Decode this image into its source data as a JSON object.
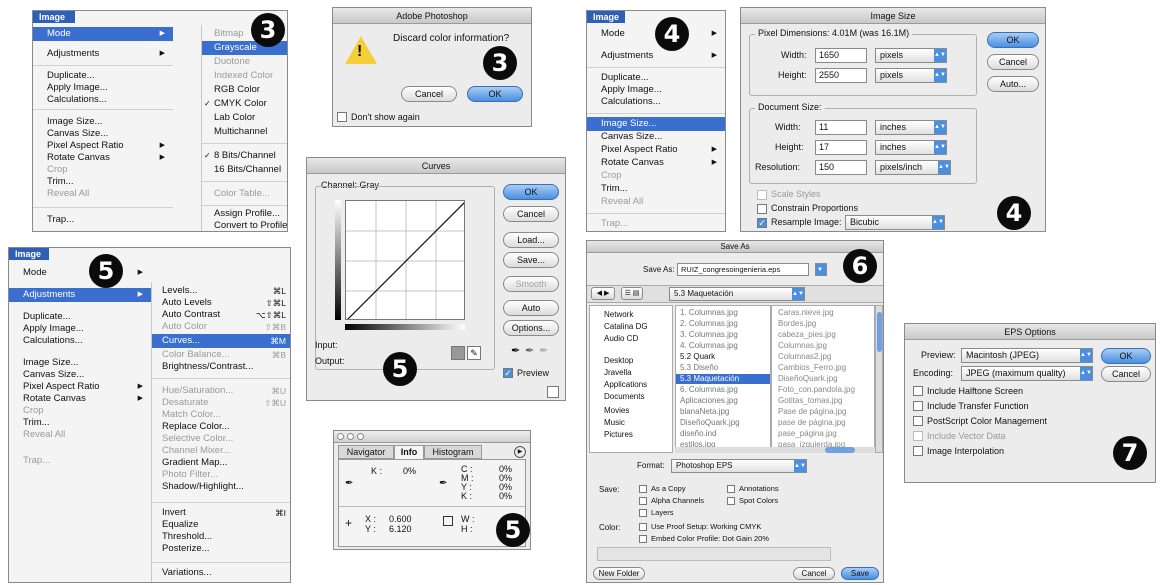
{
  "badges": [
    "3",
    "3",
    "4",
    "4",
    "5",
    "5",
    "5",
    "6",
    "7"
  ],
  "menu_mode": {
    "menubar": "Image",
    "items": [
      "Mode",
      "Adjustments",
      "Duplicate...",
      "Apply Image...",
      "Calculations...",
      "Image Size...",
      "Canvas Size...",
      "Pixel Aspect Ratio",
      "Rotate Canvas",
      "Crop",
      "Trim...",
      "Reveal All",
      "Trap..."
    ],
    "submenu": [
      "Bitmap",
      "Grayscale",
      "Duotone",
      "Indexed Color",
      "RGB Color",
      "CMYK Color",
      "Lab Color",
      "Multichannel",
      "8 Bits/Channel",
      "16 Bits/Channel",
      "Color Table...",
      "Assign Profile...",
      "Convert to Profile..."
    ],
    "check": "✓"
  },
  "alert": {
    "title": "Adobe Photoshop",
    "message": "Discard color information?",
    "cancel": "Cancel",
    "ok": "OK",
    "dont_show": "Don't show again"
  },
  "menu_imagesize": {
    "menubar": "Image",
    "items": [
      "Mode",
      "Adjustments",
      "Duplicate...",
      "Apply Image...",
      "Calculations...",
      "Image Size...",
      "Canvas Size...",
      "Pixel Aspect Ratio",
      "Rotate Canvas",
      "Crop",
      "Trim...",
      "Reveal All",
      "Trap..."
    ]
  },
  "image_size": {
    "title": "Image Size",
    "pixel_dims": "Pixel Dimensions:",
    "pixel_dims_value": "4.01M (was 16.1M)",
    "width_label": "Width:",
    "width_px": "1650",
    "height_label": "Height:",
    "height_px": "2550",
    "unit_px": "pixels",
    "doc_size": "Document Size:",
    "doc_width": "11",
    "doc_height": "17",
    "unit_in": "inches",
    "res_label": "Resolution:",
    "res": "150",
    "unit_res": "pixels/inch",
    "scale_styles": "Scale Styles",
    "constrain": "Constrain Proportions",
    "resample": "Resample Image:",
    "resample_mode": "Bicubic",
    "ok": "OK",
    "cancel": "Cancel",
    "auto": "Auto..."
  },
  "curves": {
    "title": "Curves",
    "channel_label": "Channel:",
    "channel": "Gray",
    "input": "Input:",
    "output": "Output:",
    "ok": "OK",
    "cancel": "Cancel",
    "load": "Load...",
    "save": "Save...",
    "smooth": "Smooth",
    "auto": "Auto",
    "options": "Options...",
    "preview": "Preview"
  },
  "menu_adjust": {
    "menubar": "Image",
    "items": [
      "Mode",
      "Adjustments",
      "Duplicate...",
      "Apply Image...",
      "Calculations...",
      "Image Size...",
      "Canvas Size...",
      "Pixel Aspect Ratio",
      "Rotate Canvas",
      "Crop",
      "Trim...",
      "Reveal All",
      "Trap..."
    ],
    "submenu": [
      {
        "label": "Levels...",
        "sc": "⌘L"
      },
      {
        "label": "Auto Levels",
        "sc": "⇧⌘L"
      },
      {
        "label": "Auto Contrast",
        "sc": "⌥⇧⌘L"
      },
      {
        "label": "Auto Color",
        "sc": "⇧⌘B"
      },
      {
        "label": "Curves...",
        "sc": "⌘M"
      },
      {
        "label": "Color Balance...",
        "sc": "⌘B"
      },
      {
        "label": "Brightness/Contrast...",
        "sc": ""
      },
      {
        "label": "Hue/Saturation...",
        "sc": "⌘U"
      },
      {
        "label": "Desaturate",
        "sc": "⇧⌘U"
      },
      {
        "label": "Match Color...",
        "sc": ""
      },
      {
        "label": "Replace Color...",
        "sc": ""
      },
      {
        "label": "Selective Color...",
        "sc": ""
      },
      {
        "label": "Channel Mixer...",
        "sc": ""
      },
      {
        "label": "Gradient Map...",
        "sc": ""
      },
      {
        "label": "Photo Filter...",
        "sc": ""
      },
      {
        "label": "Shadow/Highlight...",
        "sc": ""
      },
      {
        "label": "Invert",
        "sc": "⌘I"
      },
      {
        "label": "Equalize",
        "sc": ""
      },
      {
        "label": "Threshold...",
        "sc": ""
      },
      {
        "label": "Posterize...",
        "sc": ""
      },
      {
        "label": "Variations...",
        "sc": ""
      }
    ]
  },
  "info": {
    "tabs": [
      "Navigator",
      "Info",
      "Histogram"
    ],
    "k_label": "K :",
    "k_value": "0%",
    "cmyk_labels": [
      "C :",
      "M :",
      "Y :",
      "K :"
    ],
    "cmyk_values": [
      "0%",
      "0%",
      "0%",
      "0%"
    ],
    "x_label": "X :",
    "x_value": "0.600",
    "y_label": "Y :",
    "y_value": "6.120",
    "w_label": "W :",
    "h_label": "H :"
  },
  "save_as": {
    "title": "Save As",
    "save_as_label": "Save As:",
    "filename": "RUIZ_congresoingenieria.eps",
    "folder": "5.3 Maquetación",
    "sidebar": [
      "Network",
      "Catalina DG",
      "Audio CD",
      "Desktop",
      "Jravella",
      "Applications",
      "Documents",
      "Movies",
      "Music",
      "Pictures"
    ],
    "col1": [
      "1. Columnas.jpg",
      "2. Columnas.jpg",
      "3. Columnas.jpg",
      "4. Columnas.jpg",
      "5.2 Quark",
      "5.3 Diseño",
      "5.3 Maquetación",
      "6. Columnas.jpg",
      "Aplicaciones.jpg",
      "blanaNeta.jpg",
      "DiseñoQuark.jpg",
      "diseño.ind",
      "estilos.jpg"
    ],
    "col2": [
      "Caras.nieve.jpg",
      "Bordes.jpg",
      "cabeza_pies.jpg",
      "Columnas.jpg",
      "Columnas2.jpg",
      "Cambios_Ferro.jpg",
      "DiseñoQuark.jpg",
      "Foto_con.pandola.jpg",
      "Gotitas_tomas.jpg",
      "Pase de página.jpg",
      "pase de página.jpg",
      "pase_página.jpg",
      "pasa_izquierda.jpg"
    ],
    "format_label": "Format:",
    "format": "Photoshop EPS",
    "save_label": "Save:",
    "as_copy": "As a Copy",
    "annotations": "Annotations",
    "alpha": "Alpha Channels",
    "spot": "Spot Colors",
    "layers": "Layers",
    "color_label": "Color:",
    "proof": "Use Proof Setup: Working CMYK",
    "embed": "Embed Color Profile: Dot Gain 20%",
    "new_folder": "New Folder",
    "cancel": "Cancel",
    "save": "Save"
  },
  "eps": {
    "title": "EPS Options",
    "preview_label": "Preview:",
    "preview": "Macintosh (JPEG)",
    "encoding_label": "Encoding:",
    "encoding": "JPEG (maximum quality)",
    "options": [
      "Include Halftone Screen",
      "Include Transfer Function",
      "PostScript Color Management",
      "Include Vector Data",
      "Image Interpolation"
    ],
    "ok": "OK",
    "cancel": "Cancel"
  }
}
